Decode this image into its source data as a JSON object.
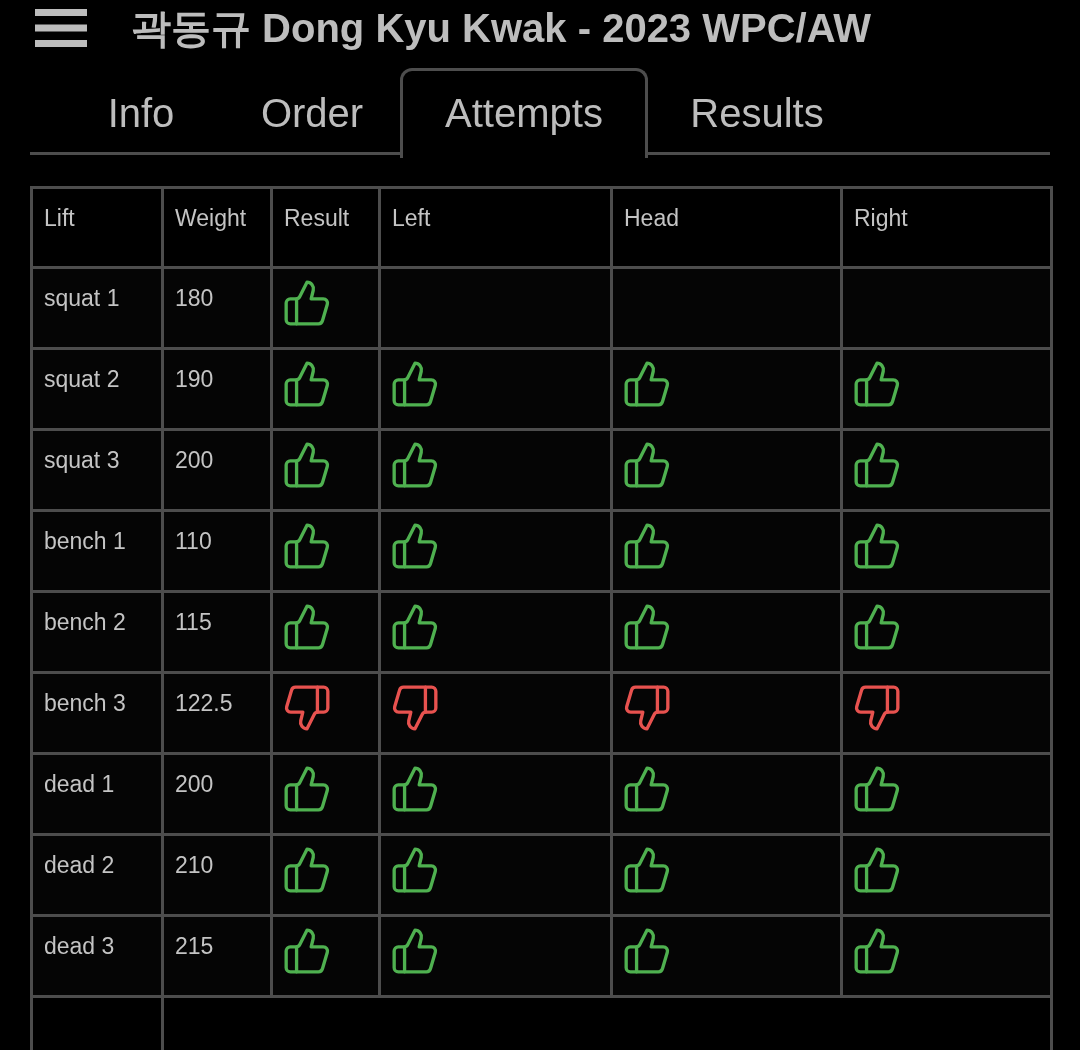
{
  "header": {
    "title": "곽동규 Dong Kyu Kwak - 2023 WPC/AW"
  },
  "tabs": [
    {
      "label": "Info",
      "selected": false
    },
    {
      "label": "Order",
      "selected": false
    },
    {
      "label": "Attempts",
      "selected": true
    },
    {
      "label": "Results",
      "selected": false
    }
  ],
  "table": {
    "columns": [
      "Lift",
      "Weight",
      "Result",
      "Left",
      "Head",
      "Right"
    ],
    "rows": [
      {
        "lift": "squat 1",
        "weight": "180",
        "passed": true
      },
      {
        "lift": "squat 2",
        "weight": "190",
        "passed": true,
        "judges": [
          {
            "passed": true
          },
          {
            "passed": true
          },
          {
            "passed": true
          }
        ]
      },
      {
        "lift": "squat 3",
        "weight": "200",
        "passed": true,
        "judges": [
          {
            "passed": true
          },
          {
            "passed": true
          },
          {
            "passed": true
          }
        ]
      },
      {
        "lift": "bench 1",
        "weight": "110",
        "passed": true,
        "judges": [
          {
            "passed": true
          },
          {
            "passed": true
          },
          {
            "passed": true
          }
        ]
      },
      {
        "lift": "bench 2",
        "weight": "115",
        "passed": true,
        "judges": [
          {
            "passed": true
          },
          {
            "passed": true
          },
          {
            "passed": true
          }
        ]
      },
      {
        "lift": "bench 3",
        "weight": "122.5",
        "passed": false,
        "judges": [
          {
            "passed": false
          },
          {
            "passed": false
          },
          {
            "passed": false
          }
        ]
      },
      {
        "lift": "dead 1",
        "weight": "200",
        "passed": true,
        "judges": [
          {
            "passed": true
          },
          {
            "passed": true
          },
          {
            "passed": true
          }
        ]
      },
      {
        "lift": "dead 2",
        "weight": "210",
        "passed": true,
        "judges": [
          {
            "passed": true
          },
          {
            "passed": true
          },
          {
            "passed": true
          }
        ]
      },
      {
        "lift": "dead 3",
        "weight": "215",
        "passed": true,
        "judges": [
          {
            "passed": true
          },
          {
            "passed": true
          },
          {
            "passed": true
          }
        ]
      }
    ]
  }
}
